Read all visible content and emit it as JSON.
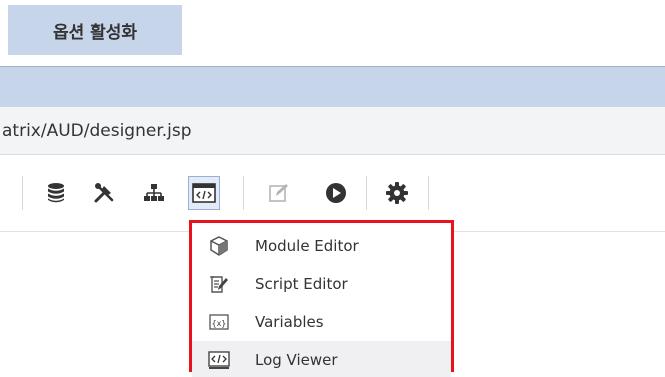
{
  "option_label": "옵션 활성화",
  "address": {
    "url": "atrix/AUD/designer.jsp"
  },
  "toolbar": {
    "buttons": [
      {
        "icon": "database-icon"
      },
      {
        "icon": "tools-icon"
      },
      {
        "icon": "hierarchy-icon"
      },
      {
        "icon": "code-window-icon",
        "active": true
      },
      {
        "icon": "edit-icon",
        "disabled": true
      },
      {
        "icon": "play-icon"
      },
      {
        "icon": "gear-icon"
      }
    ]
  },
  "dropdown": {
    "items": [
      {
        "label": "Module Editor",
        "icon": "cube-icon"
      },
      {
        "label": "Script Editor",
        "icon": "script-edit-icon"
      },
      {
        "label": "Variables",
        "icon": "variables-icon"
      },
      {
        "label": "Log Viewer",
        "icon": "log-viewer-icon",
        "highlighted": true
      }
    ],
    "highlight_color": "#e8121c"
  },
  "colors": {
    "accent": "#c7d5ea",
    "toolbar_icon": "#333333",
    "disabled_icon": "#b5b5b5"
  }
}
